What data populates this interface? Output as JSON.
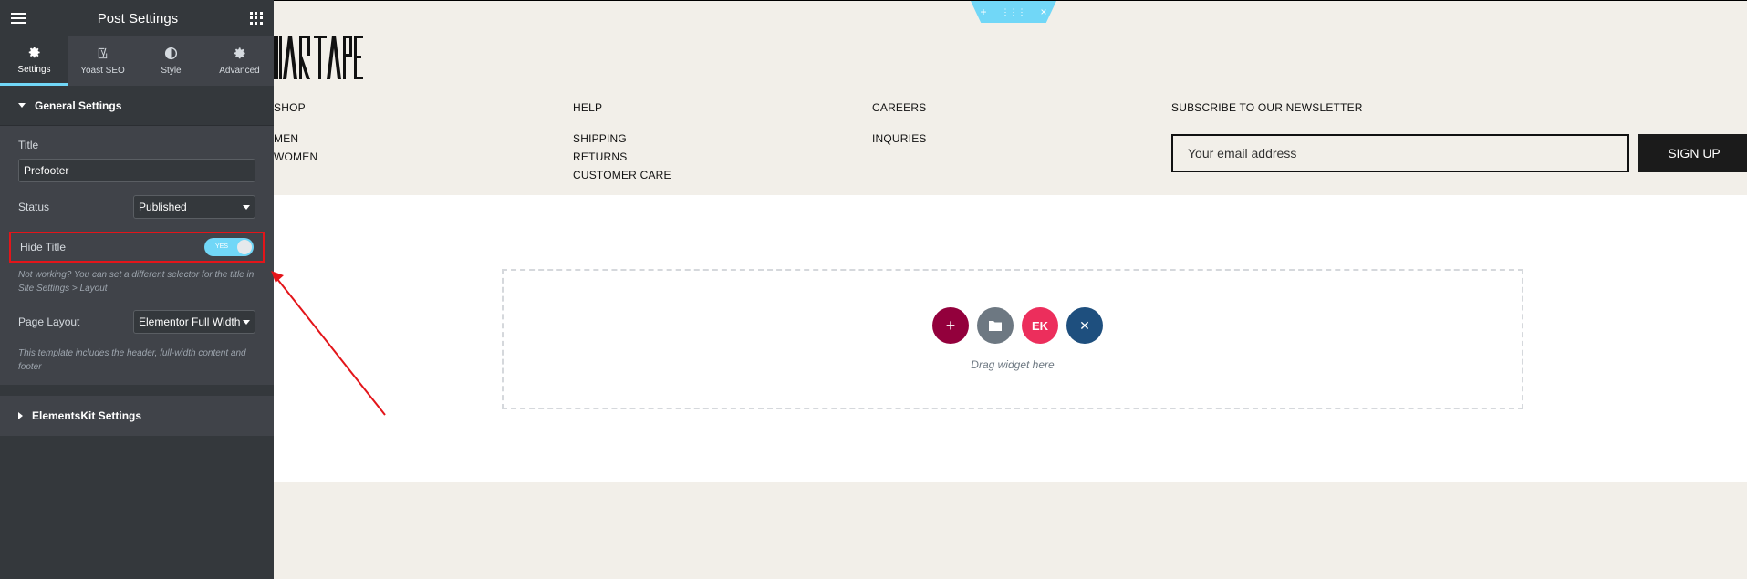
{
  "sidebar": {
    "title": "Post Settings",
    "tabs": [
      {
        "label": "Settings",
        "icon": "gear-icon"
      },
      {
        "label": "Yoast SEO",
        "icon": "yoast-icon"
      },
      {
        "label": "Style",
        "icon": "contrast-icon"
      },
      {
        "label": "Advanced",
        "icon": "gear-icon"
      }
    ],
    "general_settings": {
      "heading": "General Settings",
      "title_label": "Title",
      "title_value": "Prefooter",
      "status_label": "Status",
      "status_value": "Published",
      "hide_title_label": "Hide Title",
      "hide_title_toggle": "YES",
      "hide_title_note": "Not working? You can set a different selector for the title in Site Settings > Layout",
      "page_layout_label": "Page Layout",
      "page_layout_value": "Elementor Full Width",
      "page_layout_note": "This template includes the header, full-width content and footer"
    },
    "elementskit_heading": "ElementsKit Settings"
  },
  "canvas": {
    "section_handle": {
      "add": "+",
      "move": "⋮⋮⋮",
      "close": "×"
    },
    "footer": {
      "shop": {
        "heading": "SHOP",
        "links": [
          "MEN",
          "WOMEN"
        ]
      },
      "help": {
        "heading": "HELP",
        "links": [
          "SHIPPING",
          "RETURNS",
          "CUSTOMER CARE"
        ]
      },
      "careers": {
        "heading": "CAREERS",
        "links": [
          "INQURIES"
        ]
      },
      "newsletter": {
        "heading": "SUBSCRIBE TO OUR NEWSLETTER",
        "email_placeholder": "Your email address",
        "button": "SIGN UP"
      }
    },
    "drop_zone": {
      "text": "Drag widget here",
      "buttons": [
        {
          "name": "add-section",
          "symbol": "+",
          "color": "#93003c"
        },
        {
          "name": "template-library",
          "symbol": "▬",
          "color": "#6d7882"
        },
        {
          "name": "elementskit",
          "symbol": "EK",
          "color": "#ec2e5c"
        },
        {
          "name": "other-addon",
          "symbol": "✕",
          "color": "#1e4f7e"
        }
      ]
    }
  },
  "colors": {
    "accent": "#71d7f7",
    "highlight": "#e3151a",
    "sidebar_bg": "#34383c",
    "canvas_bg": "#f2efe9"
  }
}
